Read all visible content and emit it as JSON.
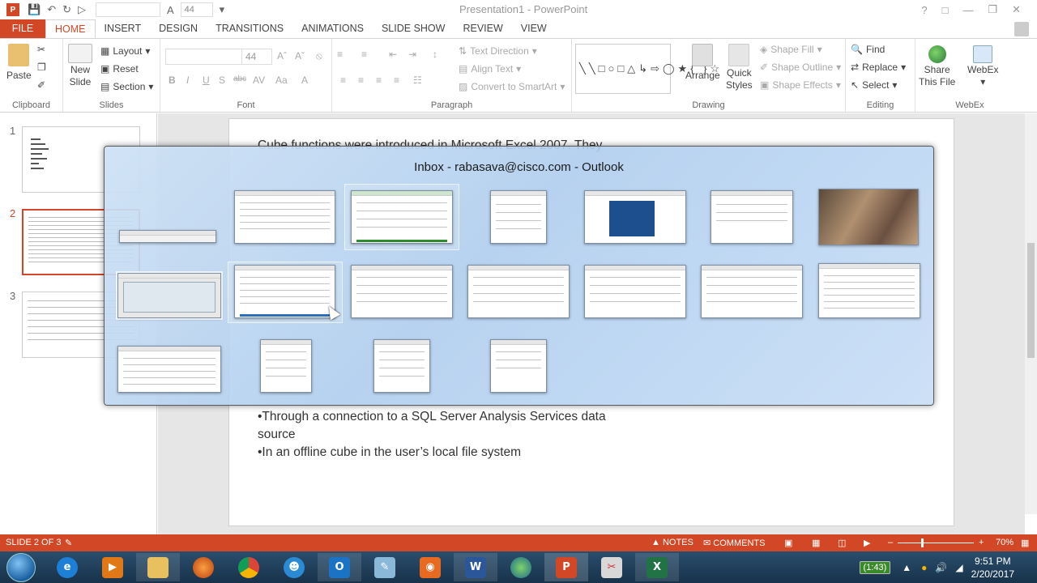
{
  "window": {
    "title": "Presentation1 - PowerPoint",
    "font_size_box": "44"
  },
  "tabs": [
    "FILE",
    "HOME",
    "INSERT",
    "DESIGN",
    "TRANSITIONS",
    "ANIMATIONS",
    "SLIDE SHOW",
    "REVIEW",
    "VIEW"
  ],
  "active_tab": "HOME",
  "ribbon": {
    "clipboard": {
      "paste": "Paste",
      "label": "Clipboard"
    },
    "slides": {
      "new_slide_1": "New",
      "new_slide_2": "Slide",
      "layout": "Layout",
      "reset": "Reset",
      "section": "Section",
      "label": "Slides"
    },
    "font": {
      "size": "44",
      "bold": "B",
      "italic": "I",
      "underline": "U",
      "strike": "abc",
      "label": "Font"
    },
    "paragraph": {
      "text_direction": "Text Direction",
      "align_text": "Align Text",
      "convert_smartart": "Convert to SmartArt",
      "label": "Paragraph"
    },
    "drawing": {
      "arrange": "Arrange",
      "quick_styles_1": "Quick",
      "quick_styles_2": "Styles",
      "shape_fill": "Shape Fill",
      "shape_outline": "Shape Outline",
      "shape_effects": "Shape Effects",
      "label": "Drawing"
    },
    "editing": {
      "find": "Find",
      "replace": "Replace",
      "select": "Select",
      "label": "Editing"
    },
    "webex": {
      "share_1": "Share",
      "share_2": "This File",
      "webex": "WebEx",
      "label": "WebEx"
    }
  },
  "thumbnails": [
    {
      "num": "1"
    },
    {
      "num": "2"
    },
    {
      "num": "3"
    }
  ],
  "slide": {
    "partial_top": "Cube functions were introduced in Microsoft Excel 2007. They",
    "bullet1_line1": "•Through a connection to a SQL Server Analysis Services data",
    "bullet1_line2": "source",
    "bullet2": "•In an offline cube in the user’s local file system"
  },
  "switcher": {
    "caption": "Inbox - rabasava@cisco.com - Outlook"
  },
  "statusbar": {
    "slide_info": "SLIDE 2 OF 3",
    "notes": "NOTES",
    "comments": "COMMENTS",
    "zoom": "70%"
  },
  "taskbar": {
    "battery": "(1:43)",
    "time": "9:51 PM",
    "date": "2/20/2017"
  },
  "colors": {
    "accent": "#d24726",
    "taskbar": "#1f3d58"
  }
}
